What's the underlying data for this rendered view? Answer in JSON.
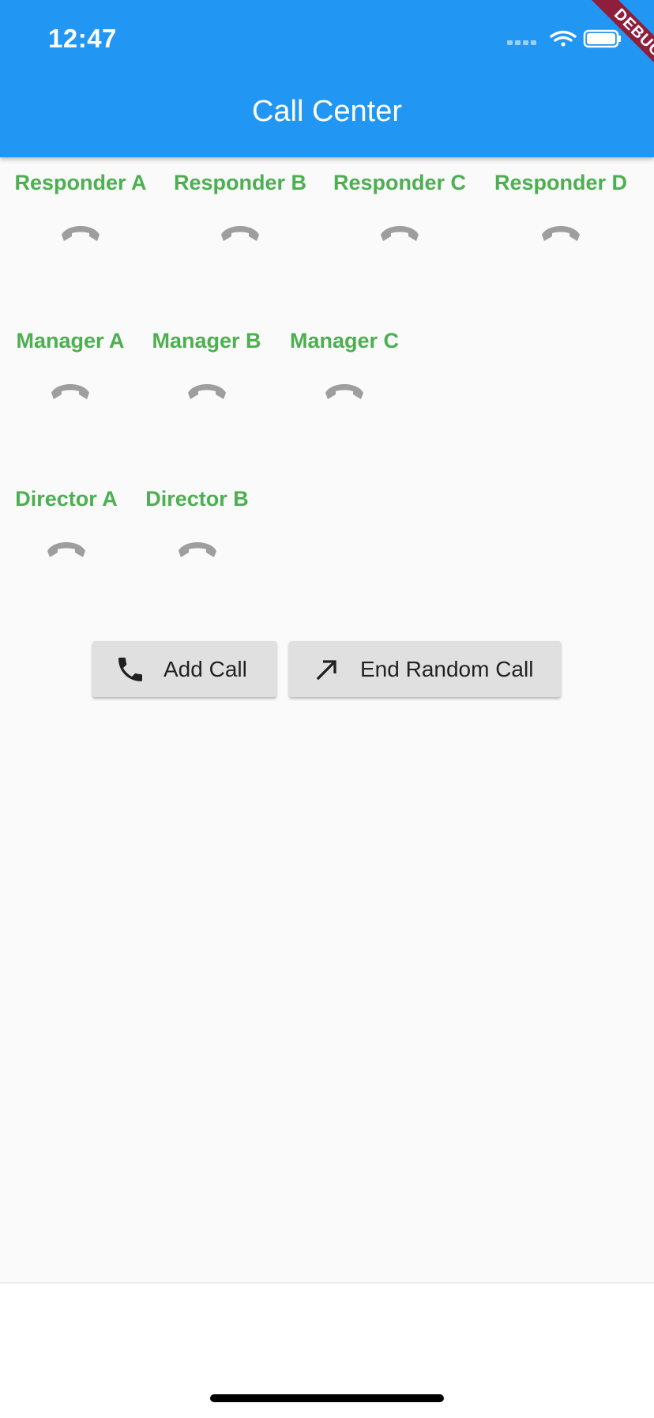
{
  "status_bar": {
    "time": "12:47"
  },
  "app_bar": {
    "title": "Call Center"
  },
  "debug_banner": "DEBUG",
  "responders": [
    {
      "name": "Responder A"
    },
    {
      "name": "Responder B"
    },
    {
      "name": "Responder C"
    },
    {
      "name": "Responder D"
    }
  ],
  "managers": [
    {
      "name": "Manager A"
    },
    {
      "name": "Manager B"
    },
    {
      "name": "Manager C"
    }
  ],
  "directors": [
    {
      "name": "Director A"
    },
    {
      "name": "Director B"
    }
  ],
  "actions": {
    "add_call": "Add Call",
    "end_random_call": "End Random Call"
  },
  "colors": {
    "app_bar": "#2196F3",
    "agent_label": "#4CAF50",
    "idle_phone_icon": "#9E9E9E",
    "button_bg": "#E0E0E0",
    "debug_ribbon": "#8E1E3C"
  },
  "icons": {
    "agent_status": "call-end-icon",
    "add_call": "phone-icon",
    "end_random_call": "arrow-up-right-icon"
  }
}
